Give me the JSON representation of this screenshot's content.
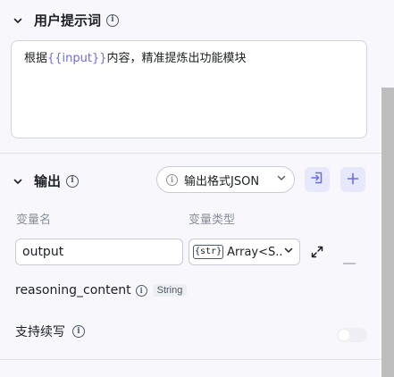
{
  "prompt_section": {
    "title": "用户提示词",
    "content_before": "根据",
    "content_var": "{{input}}",
    "content_after": "内容，精准提炼出功能模块"
  },
  "output_section": {
    "title": "输出",
    "format_label": "输出格式JSON",
    "var_name_header": "变量名",
    "var_type_header": "变量类型",
    "row": {
      "name_value": "output",
      "type_badge": "{str}",
      "type_value": "Array<S..."
    },
    "reasoning": {
      "label": "reasoning_content",
      "type": "String"
    },
    "continuation": {
      "label": "支持续写",
      "enabled": false
    }
  },
  "colors": {
    "accent": "#6b6ce6",
    "accent_bg": "#e7e8fb",
    "panel_bg": "#f7f7fc"
  }
}
